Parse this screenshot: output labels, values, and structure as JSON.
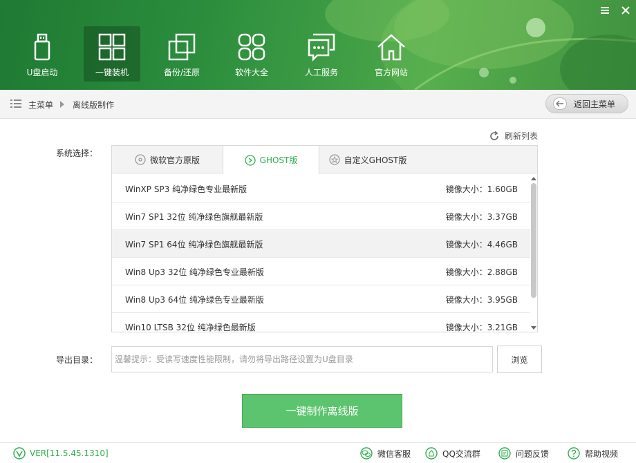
{
  "window": {
    "menu_icon": "hamburger-icon",
    "close_icon": "close-icon"
  },
  "nav": {
    "items": [
      {
        "label": "U盘启动",
        "icon": "usb-drive-icon"
      },
      {
        "label": "一键装机",
        "icon": "windows-logo-icon",
        "active": true
      },
      {
        "label": "备份/还原",
        "icon": "backup-icon"
      },
      {
        "label": "软件大全",
        "icon": "apps-grid-icon"
      },
      {
        "label": "人工服务",
        "icon": "chat-icon"
      },
      {
        "label": "官方网站",
        "icon": "home-icon"
      }
    ]
  },
  "breadcrumb": {
    "main": "主菜单",
    "current": "离线版制作",
    "back_label": "返回主菜单"
  },
  "main": {
    "refresh_label": "刷新列表",
    "system_label": "系统选择：",
    "tabs": [
      {
        "label": "微软官方原版",
        "icon": "disc-icon"
      },
      {
        "label": "GHOST版",
        "icon": "ghost-disc-icon",
        "active": true
      },
      {
        "label": "自定义GHOST版",
        "icon": "star-disc-icon"
      }
    ],
    "systems": [
      {
        "name": "WinXP SP3 纯净绿色专业最新版",
        "size": "镜像大小：1.60GB"
      },
      {
        "name": "Win7 SP1 32位 纯净绿色旗舰最新版",
        "size": "镜像大小：3.37GB"
      },
      {
        "name": "Win7 SP1 64位 纯净绿色旗舰最新版",
        "size": "镜像大小：4.46GB",
        "selected": true
      },
      {
        "name": "Win8 Up3 32位 纯净绿色专业最新版",
        "size": "镜像大小：2.88GB"
      },
      {
        "name": "Win8 Up3 64位 纯净绿色专业最新版",
        "size": "镜像大小：3.95GB"
      },
      {
        "name": "Win10 LTSB 32位 纯净绿色最新版",
        "size": "镜像大小：3.21GB"
      }
    ],
    "export_label": "导出目录：",
    "export_placeholder": "温馨提示：受读写速度性能限制，请勿将导出路径设置为U盘目录",
    "browse_label": "浏览",
    "make_button": "一键制作离线版"
  },
  "footer": {
    "version": "VER[11.5.45.1310]",
    "links": [
      {
        "label": "微信客服",
        "icon": "wechat-icon"
      },
      {
        "label": "QQ交流群",
        "icon": "qq-icon"
      },
      {
        "label": "问题反馈",
        "icon": "feedback-icon"
      },
      {
        "label": "帮助视频",
        "icon": "help-icon"
      }
    ]
  },
  "colors": {
    "brand_green": "#2fae4c",
    "button_green": "#5cc46e",
    "header_green": "#2a8c3c"
  }
}
